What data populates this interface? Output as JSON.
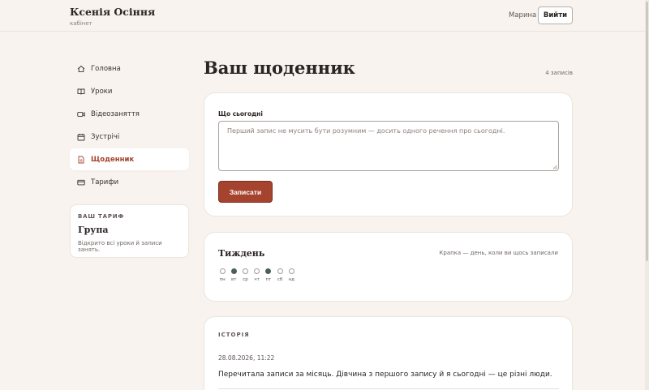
{
  "header": {
    "brand_name": "Ксенія Осіння",
    "brand_sub": "кабінет",
    "user_name": "Марина",
    "logout_label": "Вийти"
  },
  "sidebar": {
    "items": [
      {
        "label": "Головна",
        "icon": "home-icon"
      },
      {
        "label": "Уроки",
        "icon": "book-icon"
      },
      {
        "label": "Відеозаняття",
        "icon": "video-icon"
      },
      {
        "label": "Зустрічі",
        "icon": "calendar-icon"
      },
      {
        "label": "Щоденник",
        "icon": "document-icon",
        "active": true
      },
      {
        "label": "Тарифи",
        "icon": "card-icon"
      }
    ]
  },
  "plan": {
    "caption": "ВАШ ТАРИФ",
    "name": "Група",
    "description": "Відкрито всі уроки й записи занять."
  },
  "main": {
    "title": "Ваш щоденник",
    "entry_count": "4 записів"
  },
  "today": {
    "label": "Що сьогодні",
    "value": "",
    "placeholder": "Перший запис не мусить бути розумним — досить одного речення про сьогодні.",
    "submit_label": "Записати"
  },
  "week": {
    "title": "Тиждень",
    "hint": "Крапка — день, коли ви щось записали",
    "days": [
      {
        "label": "пн",
        "filled": false
      },
      {
        "label": "вт",
        "filled": true
      },
      {
        "label": "ср",
        "filled": false
      },
      {
        "label": "чт",
        "filled": false
      },
      {
        "label": "пт",
        "filled": true
      },
      {
        "label": "сб",
        "filled": false
      },
      {
        "label": "нд",
        "filled": false
      }
    ]
  },
  "history": {
    "caption": "ІСТОРІЯ",
    "entries": [
      {
        "date": "28.08.2026, 11:22",
        "text": "Перечитала записи за місяць. Дівчина з першого запису й я сьогодні — це різні люди."
      }
    ]
  },
  "colors": {
    "accent": "#a5432e",
    "background": "#f8f3ee",
    "dot_filled": "#4a5f55"
  }
}
